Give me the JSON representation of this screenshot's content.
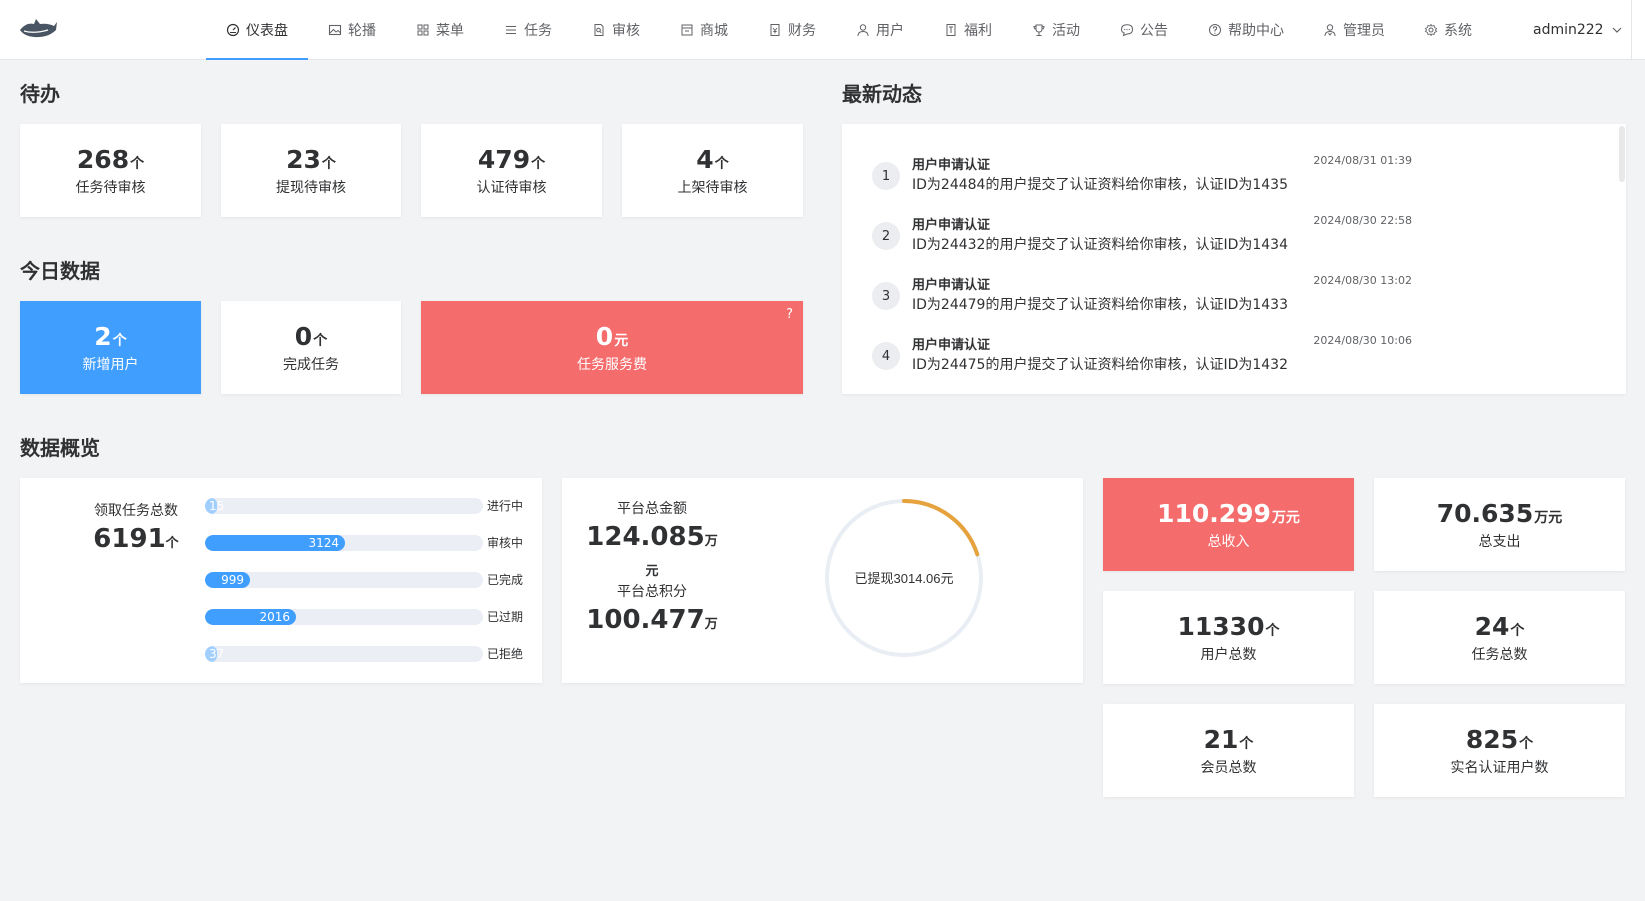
{
  "nav": {
    "items": [
      {
        "label": "仪表盘",
        "icon": "dashboard-icon",
        "active": true
      },
      {
        "label": "轮播",
        "icon": "image-icon"
      },
      {
        "label": "菜单",
        "icon": "grid-icon"
      },
      {
        "label": "任务",
        "icon": "list-icon"
      },
      {
        "label": "审核",
        "icon": "document-search-icon"
      },
      {
        "label": "商城",
        "icon": "shop-icon"
      },
      {
        "label": "财务",
        "icon": "finance-icon"
      },
      {
        "label": "用户",
        "icon": "user-icon"
      },
      {
        "label": "福利",
        "icon": "gift-card-icon"
      },
      {
        "label": "活动",
        "icon": "trophy-icon"
      },
      {
        "label": "公告",
        "icon": "chat-bubble-icon"
      },
      {
        "label": "帮助中心",
        "icon": "help-circle-icon"
      },
      {
        "label": "管理员",
        "icon": "admin-icon"
      },
      {
        "label": "系统",
        "icon": "gear-icon"
      }
    ],
    "user": "admin222",
    "accent": "#409eff"
  },
  "todo": {
    "title": "待办",
    "cards": [
      {
        "value": "268",
        "unit": "个",
        "label": "任务待审核"
      },
      {
        "value": "23",
        "unit": "个",
        "label": "提现待审核"
      },
      {
        "value": "479",
        "unit": "个",
        "label": "认证待审核"
      },
      {
        "value": "4",
        "unit": "个",
        "label": "上架待审核"
      }
    ]
  },
  "today": {
    "title": "今日数据",
    "cards": [
      {
        "value": "2",
        "unit": "个",
        "label": "新增用户",
        "color": "#409eff"
      },
      {
        "value": "0",
        "unit": "个",
        "label": "完成任务"
      },
      {
        "value": "0",
        "unit": "元",
        "label": "任务服务费",
        "color": "#f56c6c",
        "help": "?"
      }
    ]
  },
  "activity": {
    "title": "最新动态",
    "items": [
      {
        "index": "1",
        "title": "用户申请认证",
        "desc": "ID为24484的用户提交了认证资料给你审核，认证ID为1435",
        "time": "2024/08/31 01:39"
      },
      {
        "index": "2",
        "title": "用户申请认证",
        "desc": "ID为24432的用户提交了认证资料给你审核，认证ID为1434",
        "time": "2024/08/30 22:58"
      },
      {
        "index": "3",
        "title": "用户申请认证",
        "desc": "ID为24479的用户提交了认证资料给你审核，认证ID为1433",
        "time": "2024/08/30 13:02"
      },
      {
        "index": "4",
        "title": "用户申请认证",
        "desc": "ID为24475的用户提交了认证资料给你审核，认证ID为1432",
        "time": "2024/08/30 10:06"
      }
    ]
  },
  "overview": {
    "title": "数据概览",
    "tasks": {
      "label": "领取任务总数",
      "value": "6191",
      "unit": "个",
      "bars": [
        {
          "value": "15",
          "label": "进行中",
          "fraction": 0.005
        },
        {
          "value": "3124",
          "label": "审核中",
          "fraction": 0.505
        },
        {
          "value": "999",
          "label": "已完成",
          "fraction": 0.161
        },
        {
          "value": "2016",
          "label": "已过期",
          "fraction": 0.326
        },
        {
          "value": "37",
          "label": "已拒绝",
          "fraction": 0.006
        }
      ]
    },
    "platform": {
      "amount_label": "平台总金额",
      "amount_value": "124.085",
      "amount_unit": "万元",
      "points_label": "平台总积分",
      "points_value": "100.477",
      "points_unit": "万",
      "ring_text": "已提现3014.06元",
      "ring_fraction": 0.2,
      "ring_color": "#e6a23c"
    },
    "stats": [
      {
        "value": "110.299",
        "unit": "万元",
        "label": "总收入",
        "color": "#f56c6c"
      },
      {
        "value": "70.635",
        "unit": "万元",
        "label": "总支出"
      },
      {
        "value": "11330",
        "unit": "个",
        "label": "用户总数"
      },
      {
        "value": "24",
        "unit": "个",
        "label": "任务总数"
      },
      {
        "value": "21",
        "unit": "个",
        "label": "会员总数"
      },
      {
        "value": "825",
        "unit": "个",
        "label": "实名认证用户数"
      }
    ]
  }
}
